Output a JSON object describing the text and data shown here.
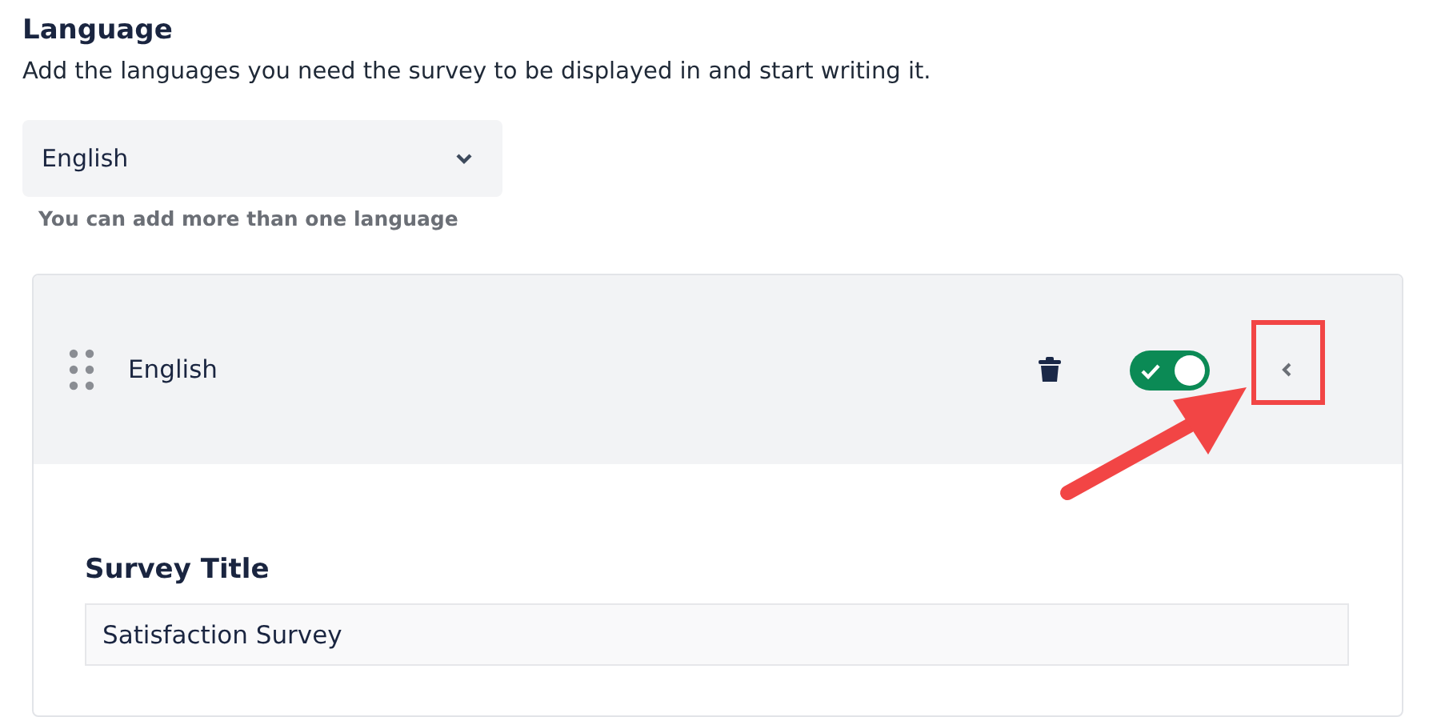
{
  "section": {
    "title": "Language",
    "description": "Add the languages you need the survey to be displayed in and start writing it."
  },
  "language_select": {
    "value": "English",
    "helper": "You can add more than one language"
  },
  "language_panel": {
    "name": "English",
    "enabled": true,
    "expanded": true,
    "fields": [
      {
        "label": "Survey Title",
        "value": "Satisfaction Survey"
      }
    ]
  }
}
